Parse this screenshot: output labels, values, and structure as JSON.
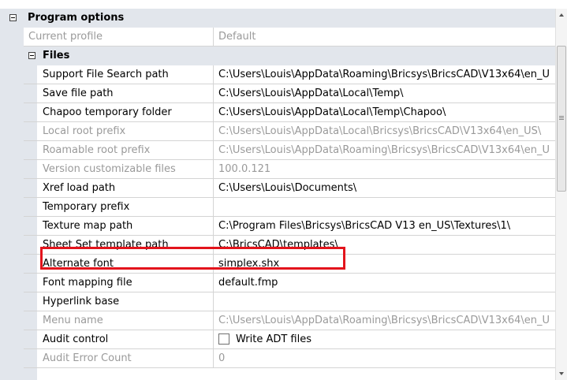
{
  "header": {
    "title": "Program options"
  },
  "current_profile": {
    "name": "Current profile",
    "value": "Default"
  },
  "files": {
    "title": "Files",
    "rows": [
      {
        "name": "Support File Search path",
        "value": "C:\\Users\\Louis\\AppData\\Roaming\\Bricsys\\BricsCAD\\V13x64\\en_U",
        "readonly": false
      },
      {
        "name": "Save file path",
        "value": "C:\\Users\\Louis\\AppData\\Local\\Temp\\",
        "readonly": false
      },
      {
        "name": "Chapoo temporary folder",
        "value": "C:\\Users\\Louis\\AppData\\Local\\Temp\\Chapoo\\",
        "readonly": false
      },
      {
        "name": "Local root prefix",
        "value": "C:\\Users\\Louis\\AppData\\Local\\Bricsys\\BricsCAD\\V13x64\\en_US\\",
        "readonly": true
      },
      {
        "name": "Roamable root prefix",
        "value": "C:\\Users\\Louis\\AppData\\Roaming\\Bricsys\\BricsCAD\\V13x64\\en_U",
        "readonly": true
      },
      {
        "name": "Version customizable files",
        "value": "100.0.121",
        "readonly": true
      },
      {
        "name": "Xref load path",
        "value": "C:\\Users\\Louis\\Documents\\",
        "readonly": false
      },
      {
        "name": "Temporary prefix",
        "value": "",
        "readonly": false
      },
      {
        "name": "Texture map path",
        "value": "C:\\Program Files\\Bricsys\\BricsCAD V13 en_US\\Textures\\1\\",
        "readonly": false
      },
      {
        "name": "Sheet Set template path",
        "value": "C:\\BricsCAD\\templates\\",
        "readonly": false
      },
      {
        "name": "Alternate font",
        "value": "simplex.shx",
        "readonly": false
      },
      {
        "name": "Font mapping file",
        "value": "default.fmp",
        "readonly": false
      },
      {
        "name": "Hyperlink base",
        "value": "",
        "readonly": false
      },
      {
        "name": "Menu name",
        "value": "C:\\Users\\Louis\\AppData\\Roaming\\Bricsys\\BricsCAD\\V13x64\\en_U",
        "readonly": true
      },
      {
        "name": "Audit control",
        "value": "Write ADT files",
        "readonly": false,
        "checkbox": true,
        "checked": false
      },
      {
        "name": "Audit Error Count",
        "value": "0",
        "readonly": true
      }
    ]
  },
  "colors": {
    "highlight": "#e3141c",
    "category_bg": "#e2e6ec",
    "readonly_text": "#9a9a9a"
  },
  "icons": {
    "expander": "minus-box-icon"
  }
}
